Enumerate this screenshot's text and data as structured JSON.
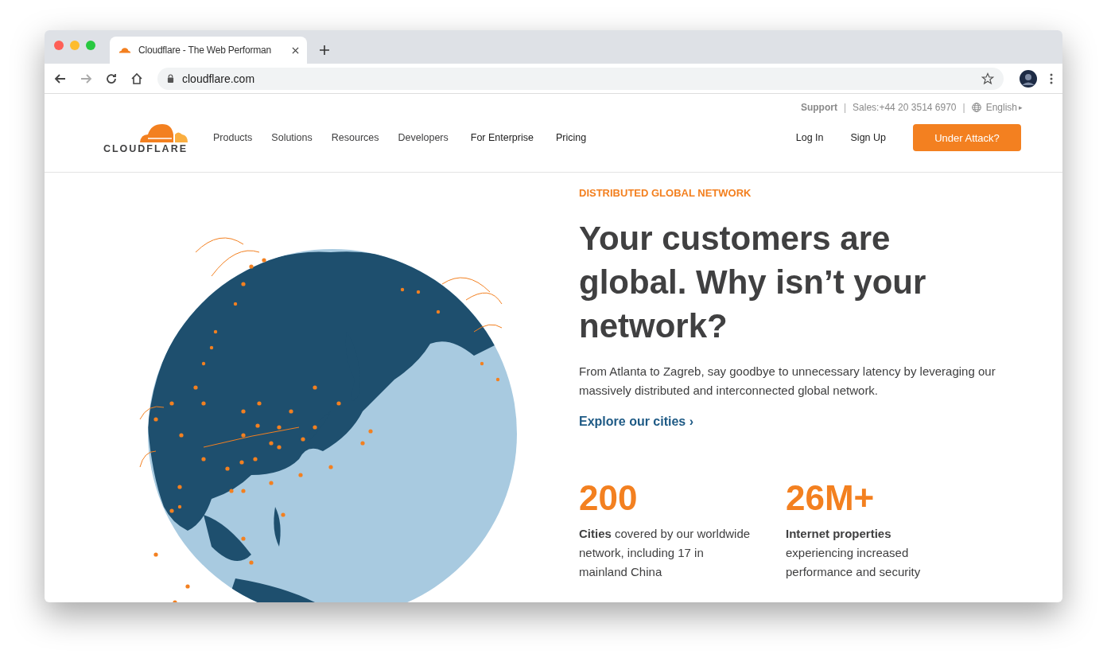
{
  "browser": {
    "tab_title": "Cloudflare - The Web Performan",
    "address": "cloudflare.com"
  },
  "top_bar": {
    "support": "Support",
    "separator_1": "|",
    "sales": "Sales:+44 20 3514 6970",
    "separator_2": "|",
    "language": "English",
    "language_caret": "▸"
  },
  "logo": {
    "wordmark": "CLOUDFLARE"
  },
  "nav": [
    "Products",
    "Solutions",
    "Resources",
    "Developers",
    "For Enterprise",
    "Pricing"
  ],
  "auth": {
    "login": "Log In",
    "signup": "Sign Up",
    "cta": "Under Attack?"
  },
  "hero": {
    "eyebrow": "DISTRIBUTED GLOBAL NETWORK",
    "title": "Your customers are global. Why isn’t your network?",
    "body": "From Atlanta to Zagreb, say goodbye to unnecessary latency by leveraging our massively distributed and interconnected global network.",
    "link": "Explore our cities ›"
  },
  "stats": [
    {
      "value": "200",
      "text": "**Cities** covered by our worldwide network, including 17 in mainland China"
    },
    {
      "value": "26M+",
      "text": "**Internet properties** experiencing increased performance and security"
    }
  ]
}
